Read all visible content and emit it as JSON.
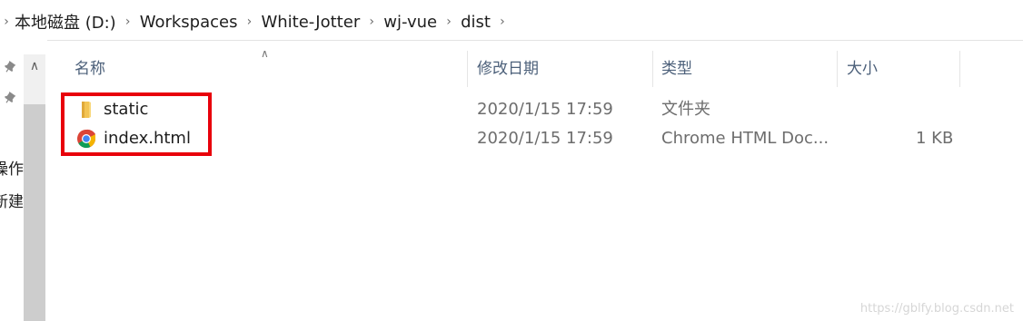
{
  "breadcrumb": {
    "items": [
      "本地磁盘 (D:)",
      "Workspaces",
      "White-Jotter",
      "wj-vue",
      "dist"
    ]
  },
  "leftnav": {
    "partial_items": [
      "操作",
      "新建"
    ]
  },
  "columns": {
    "name": "名称",
    "modified": "修改日期",
    "type": "类型",
    "size": "大小"
  },
  "files": [
    {
      "name": "static",
      "modified": "2020/1/15 17:59",
      "type": "文件夹",
      "size": "",
      "icon": "folder-icon"
    },
    {
      "name": "index.html",
      "modified": "2020/1/15 17:59",
      "type": "Chrome HTML Doc...",
      "size": "1 KB",
      "icon": "chrome-icon"
    }
  ],
  "watermark": "https://gblfy.blog.csdn.net"
}
